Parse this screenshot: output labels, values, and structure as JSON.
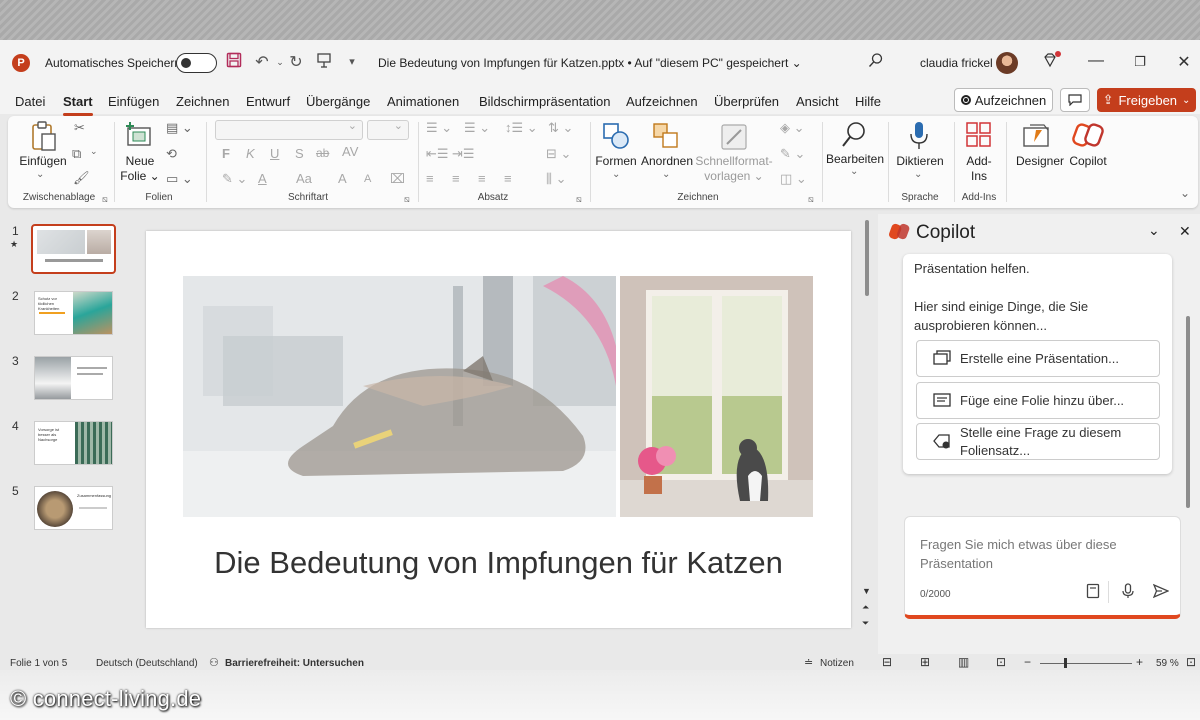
{
  "titlebar": {
    "app_logo": "P",
    "autosave_label": "Automatisches Speichern",
    "document_title": "Die Bedeutung von Impfungen für Katzen.pptx • Auf \"diesem PC\" gespeichert ⌄",
    "user_name": "claudia frickel"
  },
  "menu": {
    "tabs": [
      "Datei",
      "Start",
      "Einfügen",
      "Zeichnen",
      "Entwurf",
      "Übergänge",
      "Animationen",
      "Bildschirmpräsentation",
      "Aufzeichnen",
      "Überprüfen",
      "Ansicht",
      "Hilfe"
    ],
    "active_tab": "Start",
    "record_label": "Aufzeichnen",
    "share_label": "Freigeben"
  },
  "ribbon": {
    "paste_label": "Einfügen",
    "new_slide_label_1": "Neue",
    "new_slide_label_2": "Folie ⌄",
    "shapes_label": "Formen",
    "arrange_label": "Anordnen",
    "quick_styles_label_1": "Schnellformat-",
    "quick_styles_label_2": "vorlagen ⌄",
    "edit_label": "Bearbeiten",
    "dictate_label": "Diktieren",
    "addins_label_1": "Add-",
    "addins_label_2": "Ins",
    "designer_label": "Designer",
    "copilot_label": "Copilot",
    "group_labels": {
      "clipboard": "Zwischenablage",
      "slides": "Folien",
      "font": "Schriftart",
      "paragraph": "Absatz",
      "drawing": "Zeichnen",
      "voice": "Sprache",
      "addins": "Add-Ins"
    },
    "font_buttons": [
      "F",
      "K",
      "U",
      "S",
      "ab",
      "AV",
      "Aa",
      "A",
      "A"
    ]
  },
  "thumbnails": [
    "1",
    "2",
    "3",
    "4",
    "5"
  ],
  "thumb_texts": {
    "t2": "Schutz vor tödlichen Krankheiten",
    "t4": "Vorsorge ist besser als Nachsorge",
    "t5": "Zusammenfassung"
  },
  "slide": {
    "title": "Die Bedeutung von Impfungen für Katzen"
  },
  "copilot": {
    "title": "Copilot",
    "intro_line": "Präsentation helfen.",
    "hint": "Hier sind einige Dinge, die Sie ausprobieren können...",
    "suggestions": {
      "s1": "Erstelle eine Präsentation...",
      "s2": "Füge eine Folie hinzu über...",
      "s3": "Stelle eine Frage zu diesem Foliensatz..."
    },
    "input_placeholder": "Fragen Sie mich etwas über diese Präsentation",
    "char_count": "0/2000"
  },
  "statusbar": {
    "slide_info": "Folie 1 von 5",
    "language": "Deutsch (Deutschland)",
    "accessibility": "Barrierefreiheit: Untersuchen",
    "notes": "Notizen",
    "zoom": "59 %"
  },
  "watermark": "© connect-living.de",
  "colors": {
    "accent": "#c43e1c",
    "copilot_accent": "#e0481f"
  }
}
